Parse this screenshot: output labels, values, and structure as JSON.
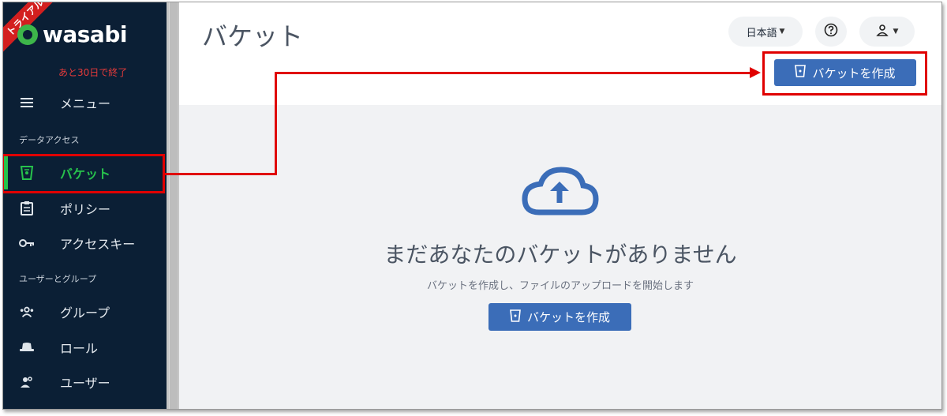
{
  "sidebar": {
    "trial_ribbon": "トライアル",
    "logo_text": "wasabi",
    "trial_remaining": "あと30日で終了",
    "menu_label": "メニュー",
    "section_data_access": "データアクセス",
    "section_users_groups": "ユーザーとグループ",
    "items": [
      {
        "label": "バケット",
        "icon": "bucket-icon",
        "active": true
      },
      {
        "label": "ポリシー",
        "icon": "clipboard-icon"
      },
      {
        "label": "アクセスキー",
        "icon": "key-icon"
      },
      {
        "label": "グループ",
        "icon": "group-icon"
      },
      {
        "label": "ロール",
        "icon": "hat-icon"
      },
      {
        "label": "ユーザー",
        "icon": "users-icon"
      }
    ]
  },
  "header": {
    "title": "バケット",
    "language": "日本語",
    "help_icon": "help-circle-icon",
    "user_icon": "user-icon"
  },
  "toolbar": {
    "create_bucket_label": "バケットを作成"
  },
  "empty_state": {
    "icon": "cloud-upload-icon",
    "title": "まだあなたのバケットがありません",
    "subtitle": "バケットを作成し、ファイルのアップロードを開始します",
    "create_bucket_label": "バケットを作成"
  },
  "colors": {
    "sidebar_bg": "#0b1f35",
    "active_green": "#27c24c",
    "primary_blue": "#3b6db8",
    "annotation_red": "#e00000",
    "trial_red": "#d31f1f"
  }
}
